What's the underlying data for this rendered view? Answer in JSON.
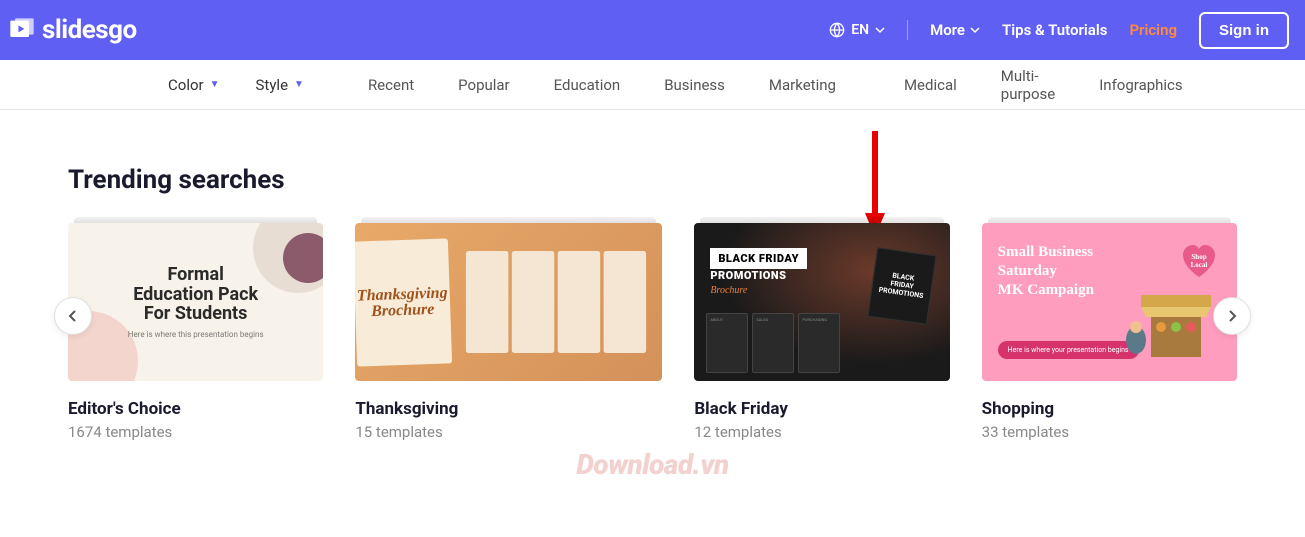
{
  "header": {
    "logo": "slidesgo",
    "lang": "EN",
    "more": "More",
    "links": [
      "Tips & Tutorials",
      "Pricing"
    ],
    "signin": "Sign in"
  },
  "subnav": {
    "filters": [
      "Color",
      "Style"
    ],
    "categories": [
      "Recent",
      "Popular",
      "Education",
      "Business",
      "Marketing",
      "Medical",
      "Multi-purpose",
      "Infographics"
    ]
  },
  "section": {
    "title": "Trending searches"
  },
  "cards": [
    {
      "title": "Editor's Choice",
      "sub": "1674 templates",
      "imgTitle": "Formal Education Pack For Students",
      "imgSub": "Here is where this presentation begins"
    },
    {
      "title": "Thanksgiving",
      "sub": "15 templates",
      "imgTitle": "Thanksgiving",
      "imgSub": "Brochure"
    },
    {
      "title": "Black Friday",
      "sub": "12 templates",
      "imgTitle1": "BLACK FRIDAY",
      "imgTitle2": "PROMOTIONS",
      "imgSub": "Brochure",
      "side1": "BLACK",
      "side2": "FRIDAY",
      "side3": "PROMOTIONS"
    },
    {
      "title": "Shopping",
      "sub": "33 templates",
      "imgTitle": "Small Business Saturday MK Campaign",
      "badge": "Shop Local",
      "btn": "Here is where your presentation begins"
    }
  ],
  "watermark": "Download.vn"
}
